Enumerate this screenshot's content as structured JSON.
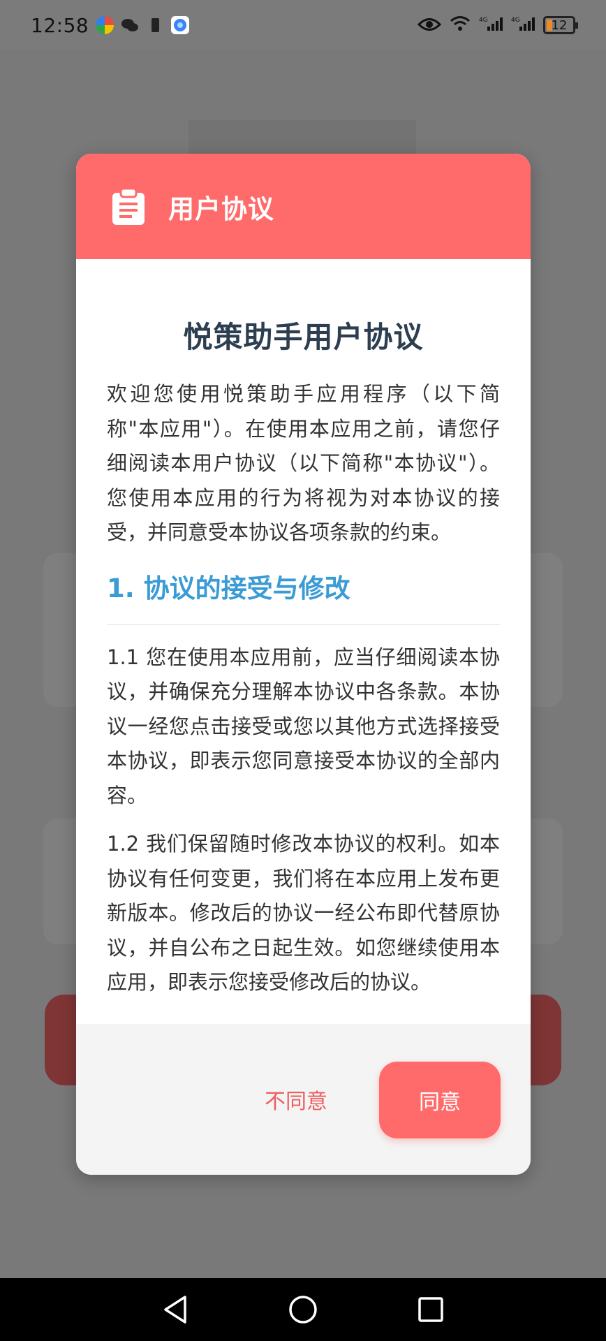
{
  "status_bar": {
    "time": "12:58",
    "battery_level": "12"
  },
  "dialog": {
    "title": "用户协议",
    "icon": "clipboard-icon",
    "heading": "悦策助手用户协议",
    "intro": "欢迎您使用悦策助手应用程序（以下简称\"本应用\"）。在使用本应用之前，请您仔细阅读本用户协议（以下简称\"本协议\"）。您使用本应用的行为将视为对本协议的接受，并同意受本协议各项条款的约束。",
    "section_1_title": "1. 协议的接受与修改",
    "section_1_1": "1.1 您在使用本应用前，应当仔细阅读本协议，并确保充分理解本协议中各条款。本协议一经您点击接受或您以其他方式选择接受本协议，即表示您同意接受本协议的全部内容。",
    "section_1_2": "1.2 我们保留随时修改本协议的权利。如本协议有任何变更，我们将在本应用上发布更新版本。修改后的协议一经公布即代替原协议，并自公布之日起生效。如您继续使用本应用，即表示您接受修改后的协议。",
    "disagree_label": "不同意",
    "agree_label": "同意"
  },
  "colors": {
    "accent": "#ff6b6b",
    "section_title": "#3a9bd5",
    "heading": "#2c3e50"
  },
  "nav": {
    "back": "back-icon",
    "home": "home-icon",
    "recents": "recents-icon"
  }
}
